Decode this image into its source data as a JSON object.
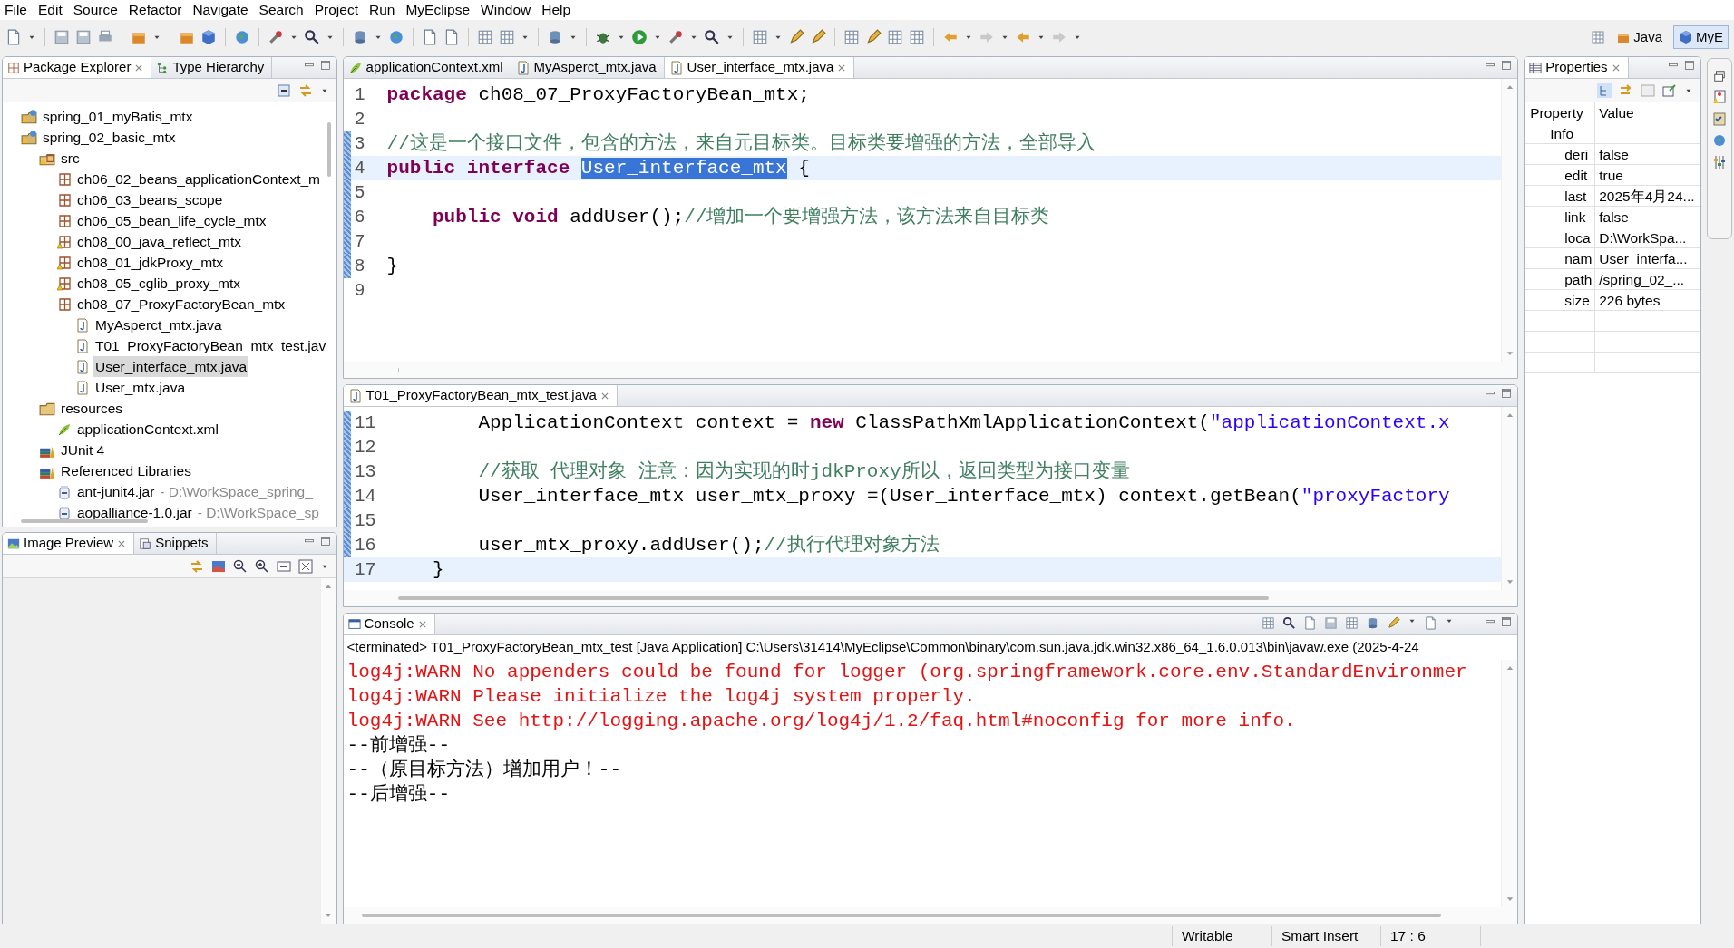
{
  "menu": [
    "File",
    "Edit",
    "Source",
    "Refactor",
    "Navigate",
    "Search",
    "Project",
    "Run",
    "MyEclipse",
    "Window",
    "Help"
  ],
  "perspectives": [
    {
      "label": "Java",
      "selected": false
    },
    {
      "label": "MyE",
      "selected": true
    }
  ],
  "package_explorer": {
    "tabs": [
      {
        "label": "Package Explorer",
        "selected": true
      },
      {
        "label": "Type Hierarchy",
        "selected": false
      }
    ],
    "tree": [
      {
        "label": "spring_01_myBatis_mtx",
        "kind": "project",
        "selected": false
      },
      {
        "label": "spring_02_basic_mtx",
        "kind": "project",
        "selected": false,
        "children": [
          {
            "label": "src",
            "kind": "source-folder",
            "selected": false,
            "children": [
              {
                "label": "ch06_02_beans_applicationContext_m",
                "kind": "package",
                "warning": false,
                "selected": false
              },
              {
                "label": "ch06_03_beans_scope",
                "kind": "package",
                "warning": false,
                "selected": false
              },
              {
                "label": "ch06_05_bean_life_cycle_mtx",
                "kind": "package",
                "warning": false,
                "selected": false
              },
              {
                "label": "ch08_00_java_reflect_mtx",
                "kind": "package",
                "warning": true,
                "selected": false
              },
              {
                "label": "ch08_01_jdkProxy_mtx",
                "kind": "package",
                "warning": true,
                "selected": false
              },
              {
                "label": "ch08_05_cglib_proxy_mtx",
                "kind": "package",
                "warning": true,
                "selected": false
              },
              {
                "label": "ch08_07_ProxyFactoryBean_mtx",
                "kind": "package",
                "warning": false,
                "selected": false,
                "children": [
                  {
                    "label": "MyAsperct_mtx.java",
                    "kind": "java",
                    "selected": false
                  },
                  {
                    "label": "T01_ProxyFactoryBean_mtx_test.jav",
                    "kind": "java",
                    "selected": false
                  },
                  {
                    "label": "User_interface_mtx.java",
                    "kind": "java",
                    "selected": true
                  },
                  {
                    "label": "User_mtx.java",
                    "kind": "java",
                    "selected": false
                  }
                ]
              }
            ]
          },
          {
            "label": "resources",
            "kind": "folder",
            "selected": false,
            "children": [
              {
                "label": "applicationContext.xml",
                "kind": "xml",
                "selected": false
              }
            ]
          },
          {
            "label": "JUnit 4",
            "kind": "library",
            "selected": false
          },
          {
            "label": "Referenced Libraries",
            "kind": "library",
            "selected": false,
            "children": [
              {
                "label": "ant-junit4.jar",
                "detail": "- D:\\WorkSpace_spring_",
                "kind": "jar",
                "selected": false
              },
              {
                "label": "aopalliance-1.0.jar",
                "detail": "- D:\\WorkSpace_sp",
                "kind": "jar",
                "selected": false
              }
            ]
          }
        ]
      }
    ]
  },
  "image_preview": {
    "tabs": [
      {
        "label": "Image Preview",
        "selected": true
      },
      {
        "label": "Snippets",
        "selected": false
      }
    ]
  },
  "editor": {
    "tabs": [
      {
        "label": "applicationContext.xml",
        "kind": "xml",
        "selected": false
      },
      {
        "label": "MyAsperct_mtx.java",
        "kind": "java",
        "selected": false
      },
      {
        "label": "User_interface_mtx.java",
        "kind": "java",
        "selected": true
      }
    ],
    "lines": [
      {
        "number": "1",
        "marked": false,
        "current": false,
        "segments": [
          {
            "kind": "keyword",
            "text": "package"
          },
          {
            "kind": "plain",
            "text": " ch08_07_ProxyFactoryBean_mtx;"
          }
        ]
      },
      {
        "number": "2",
        "marked": false,
        "current": false
      },
      {
        "number": "3",
        "marked": true,
        "current": false,
        "segments": [
          {
            "kind": "comment",
            "text": "//这是一个接口文件，包含的方法，来自元目标类。目标类要增强的方法，全部导入"
          }
        ]
      },
      {
        "number": "4",
        "marked": true,
        "current": true,
        "segments": [
          {
            "kind": "keyword",
            "text": "public"
          },
          {
            "kind": "keyword",
            "text": " interface "
          },
          {
            "kind": "selected",
            "text": "User_interface_mtx"
          },
          {
            "kind": "plain",
            "text": " {"
          }
        ]
      },
      {
        "number": "5",
        "marked": true,
        "current": false
      },
      {
        "number": "6",
        "marked": true,
        "current": false,
        "segments": [
          {
            "kind": "keyword",
            "text": "    public"
          },
          {
            "kind": "keyword",
            "text": " void"
          },
          {
            "kind": "plain",
            "text": " addUser();"
          },
          {
            "kind": "comment",
            "text": "//增加一个要增强方法，该方法来自目标类"
          }
        ]
      },
      {
        "number": "7",
        "marked": true,
        "current": false
      },
      {
        "number": "8",
        "marked": true,
        "current": false,
        "segments": [
          {
            "kind": "plain",
            "text": "}"
          }
        ]
      },
      {
        "number": "9",
        "marked": false,
        "current": false
      }
    ]
  },
  "test_editor": {
    "tabs": [
      {
        "label": "T01_ProxyFactoryBean_mtx_test.java",
        "kind": "java",
        "selected": true
      }
    ],
    "lines": [
      {
        "number": "11",
        "marked": true,
        "current": false,
        "segments": [
          {
            "kind": "plain",
            "text": "        ApplicationContext context = "
          },
          {
            "kind": "keyword",
            "text": "new"
          },
          {
            "kind": "plain",
            "text": " ClassPathXmlApplicationContext("
          },
          {
            "kind": "string",
            "text": "\"applicationContext.x"
          }
        ]
      },
      {
        "number": "12",
        "marked": true,
        "current": false
      },
      {
        "number": "13",
        "marked": true,
        "current": false,
        "segments": [
          {
            "kind": "comment",
            "text": "        //获取 代理对象 注意：因为实现的时jdkProxy所以，返回类型为接口变量"
          }
        ]
      },
      {
        "number": "14",
        "marked": true,
        "current": false,
        "segments": [
          {
            "kind": "plain",
            "text": "        User_interface_mtx user_mtx_proxy =(User_interface_mtx) context.getBean("
          },
          {
            "kind": "string",
            "text": "\"proxyFactory"
          }
        ]
      },
      {
        "number": "15",
        "marked": true,
        "current": false
      },
      {
        "number": "16",
        "marked": true,
        "current": false,
        "segments": [
          {
            "kind": "plain",
            "text": "        user_mtx_proxy.addUser();"
          },
          {
            "kind": "comment",
            "text": "//执行代理对象方法"
          }
        ]
      },
      {
        "number": "17",
        "marked": false,
        "current": true,
        "segments": [
          {
            "kind": "plain",
            "text": "    }"
          }
        ]
      }
    ]
  },
  "console": {
    "tabs": [
      {
        "label": "Console",
        "selected": true
      }
    ],
    "header": "<terminated> T01_ProxyFactoryBean_mtx_test [Java Application] C:\\Users\\31414\\MyEclipse\\Common\\binary\\com.sun.java.jdk.win32.x86_64_1.6.0.013\\bin\\javaw.exe (2025-4-24",
    "lines": [
      {
        "kind": "stderr",
        "text": "log4j:WARN No appenders could be found for logger (org.springframework.core.env.StandardEnvironmer"
      },
      {
        "kind": "stderr",
        "text": "log4j:WARN Please initialize the log4j system properly."
      },
      {
        "kind": "stderr",
        "text": "log4j:WARN See http://logging.apache.org/log4j/1.2/faq.html#noconfig for more info."
      },
      {
        "kind": "stdout",
        "text": "--前增强--"
      },
      {
        "kind": "stdout",
        "text": "--（原目标方法）增加用户！--"
      },
      {
        "kind": "stdout",
        "text": "--后增强--"
      }
    ]
  },
  "properties": {
    "tabs": [
      {
        "label": "Properties",
        "selected": true
      }
    ],
    "columns": [
      "Property",
      "Value"
    ],
    "category": "Info",
    "rows": [
      {
        "property": "deri",
        "value": "false"
      },
      {
        "property": "edit",
        "value": "true"
      },
      {
        "property": "last",
        "value": "2025年4月24..."
      },
      {
        "property": "link",
        "value": "false"
      },
      {
        "property": "loca",
        "value": "D:\\WorkSpa..."
      },
      {
        "property": "nam",
        "value": "User_interfa..."
      },
      {
        "property": "path",
        "value": "/spring_02_..."
      },
      {
        "property": "size",
        "value": "226  bytes"
      }
    ]
  },
  "status_bar": [
    "Writable",
    "Smart Insert",
    "17 : 6"
  ]
}
